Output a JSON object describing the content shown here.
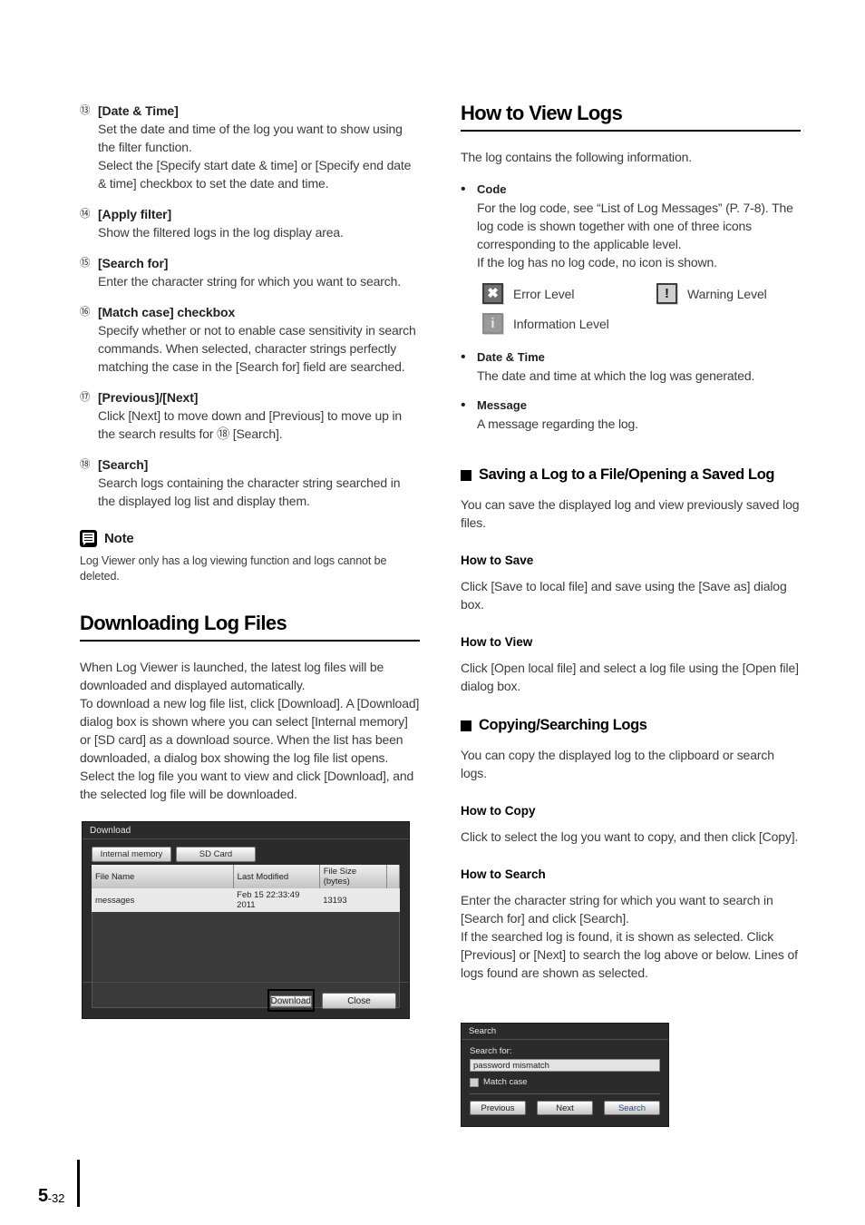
{
  "left_column": {
    "numbered_items": [
      {
        "num": "⑬",
        "term": "[Date & Time]",
        "desc": "Set the date and time of the log you want to show using the filter function.\nSelect the [Specify start date & time] or [Specify end date & time] checkbox to set the date and time."
      },
      {
        "num": "⑭",
        "term": "[Apply filter]",
        "desc": "Show the filtered logs in the log display area."
      },
      {
        "num": "⑮",
        "term": "[Search for]",
        "desc": "Enter the character string for which you want to search."
      },
      {
        "num": "⑯",
        "term": "[Match case] checkbox",
        "desc": "Specify whether or not to enable case sensitivity in search commands. When selected, character strings perfectly matching the case in the [Search for] field are searched."
      },
      {
        "num": "⑰",
        "term": "[Previous]/[Next]",
        "desc": "Click [Next] to move down and [Previous] to move up in the search results for ⑱ [Search]."
      },
      {
        "num": "⑱",
        "term": "[Search]",
        "desc": "Search logs containing the character string searched in the displayed log list and display them."
      }
    ],
    "note": {
      "icon": "note-icon",
      "title": "Note",
      "text": "Log Viewer only has a log viewing function and logs cannot be deleted."
    },
    "section": {
      "heading": "Downloading Log Files",
      "paragraph": "When Log Viewer is launched, the latest log files will be downloaded and displayed automatically.\nTo download a new log file list, click [Download]. A [Download] dialog box is shown where you can select [Internal memory] or [SD card] as a download source. When the list has been downloaded, a dialog box showing the log file list opens. Select the log file you want to view and click [Download], and the selected log file will be downloaded."
    }
  },
  "download_dialog": {
    "title": "Download",
    "tabs": [
      {
        "label": "Internal memory",
        "active": true
      },
      {
        "label": "SD Card",
        "active": false
      }
    ],
    "columns": [
      "File Name",
      "Last Modified",
      "File Size (bytes)"
    ],
    "rows": [
      {
        "file_name": "messages",
        "last_modified": "Feb 15 22:33:49 2011",
        "file_size": "13193"
      }
    ],
    "buttons": {
      "download": "Download",
      "close": "Close"
    }
  },
  "right_column": {
    "section1": {
      "heading": "How to View Logs",
      "intro": "The log contains the following information.",
      "bullets": [
        {
          "term": "Code",
          "desc": "For the log code, see “List of Log Messages” (P. 7-8). The log code is shown together with one of three icons corresponding to the applicable level.\nIf the log has no log code, no icon is shown."
        },
        {
          "term": "Date & Time",
          "desc": "The date and time at which the log was generated."
        },
        {
          "term": "Message",
          "desc": "A message regarding the log."
        }
      ],
      "levels": [
        {
          "icon": "error-level-icon",
          "glyph": "✖",
          "label": "Error Level"
        },
        {
          "icon": "warning-level-icon",
          "glyph": "!",
          "label": "Warning Level"
        },
        {
          "icon": "information-level-icon",
          "glyph": "i",
          "label": "Information Level"
        }
      ]
    },
    "section2": {
      "heading": "Saving a Log to a File/Opening a Saved Log",
      "intro": "You can save the displayed log and view previously saved log files.",
      "sub1_heading": "How to Save",
      "sub1_text": "Click [Save to local file] and save using the [Save as] dialog box.",
      "sub2_heading": "How to View",
      "sub2_text": "Click [Open local file] and select a log file using the [Open file] dialog box."
    },
    "section3": {
      "heading": "Copying/Searching Logs",
      "intro": "You can copy the displayed log to the clipboard or search logs.",
      "sub1_heading": "How to Copy",
      "sub1_text": "Click to select the log you want to copy, and then click [Copy].",
      "sub2_heading": "How to Search",
      "sub2_text": "Enter the character string for which you want to search in [Search for] and click [Search].\nIf the searched log is found, it is shown as selected. Click [Previous] or [Next] to search the log above or below. Lines of logs found are shown as selected."
    }
  },
  "search_dialog": {
    "title": "Search",
    "search_for_label": "Search for:",
    "search_for_value": "password mismatch",
    "match_case_label": "Match case",
    "buttons": {
      "previous": "Previous",
      "next": "Next",
      "search": "Search"
    },
    "accent_color": "#1d4f9e"
  },
  "footer": {
    "page_number": "5",
    "page_suffix": "-32"
  }
}
